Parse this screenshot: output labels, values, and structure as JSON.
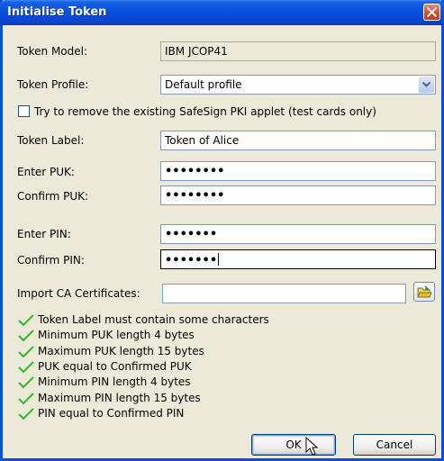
{
  "window": {
    "title": "Initialise Token"
  },
  "token_model": {
    "label": "Token Model:",
    "value": "IBM JCOP41"
  },
  "token_profile": {
    "label": "Token Profile:",
    "value": "Default profile"
  },
  "remove_applet": {
    "label": "Try to remove the existing SafeSign PKI applet (test cards only)",
    "checked": false
  },
  "token_label": {
    "label": "Token Label:",
    "value": "Token of Alice"
  },
  "enter_puk": {
    "label": "Enter PUK:",
    "value": "••••••••"
  },
  "confirm_puk": {
    "label": "Confirm PUK:",
    "value": "••••••••"
  },
  "enter_pin": {
    "label": "Enter PIN:",
    "value": "•••••••"
  },
  "confirm_pin": {
    "label": "Confirm PIN:",
    "value": "•••••••"
  },
  "import_ca": {
    "label": "Import CA Certificates:",
    "value": ""
  },
  "validations": [
    "Token Label must contain some characters",
    "Minimum PUK length 4 bytes",
    "Maximum PUK length 15 bytes",
    "PUK equal to Confirmed PUK",
    "Minimum PIN length 4 bytes",
    "Maximum PIN length 15 bytes",
    "PIN equal to Confirmed PIN"
  ],
  "buttons": {
    "ok": "OK",
    "cancel": "Cancel"
  },
  "colors": {
    "titlebar": "#0a52e0",
    "dialog_bg": "#ece9d8",
    "check_green": "#2fb82f",
    "close_red": "#d8472a"
  }
}
